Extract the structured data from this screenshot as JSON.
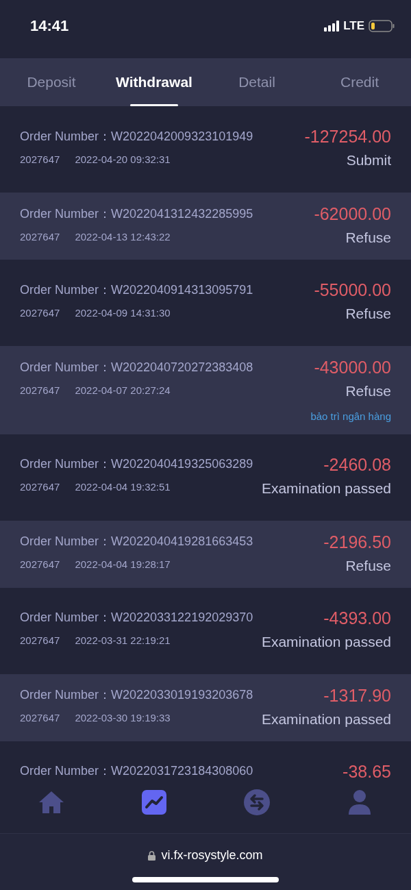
{
  "status_bar": {
    "time": "14:41",
    "network": "LTE"
  },
  "tabs": [
    {
      "label": "Deposit",
      "selected": false
    },
    {
      "label": "Withdrawal",
      "selected": true
    },
    {
      "label": "Detail",
      "selected": false
    },
    {
      "label": "Credit",
      "selected": false
    }
  ],
  "orders": [
    {
      "order_label": "Order Number：",
      "order_number": "W2022042009323101949",
      "account": "2027647",
      "time": "2022-04-20 09:32:31",
      "amount": "-127254.00",
      "status": "Submit"
    },
    {
      "order_label": "Order Number：",
      "order_number": "W2022041312432285995",
      "account": "2027647",
      "time": "2022-04-13 12:43:22",
      "amount": "-62000.00",
      "status": "Refuse"
    },
    {
      "order_label": "Order Number：",
      "order_number": "W2022040914313095791",
      "account": "2027647",
      "time": "2022-04-09 14:31:30",
      "amount": "-55000.00",
      "status": "Refuse"
    },
    {
      "order_label": "Order Number：",
      "order_number": "W2022040720272383408",
      "account": "2027647",
      "time": "2022-04-07 20:27:24",
      "amount": "-43000.00",
      "status": "Refuse",
      "note": "bảo trì ngân hàng"
    },
    {
      "order_label": "Order Number：",
      "order_number": "W2022040419325063289",
      "account": "2027647",
      "time": "2022-04-04 19:32:51",
      "amount": "-2460.08",
      "status": "Examination passed"
    },
    {
      "order_label": "Order Number：",
      "order_number": "W2022040419281663453",
      "account": "2027647",
      "time": "2022-04-04 19:28:17",
      "amount": "-2196.50",
      "status": "Refuse"
    },
    {
      "order_label": "Order Number：",
      "order_number": "W2022033122192029370",
      "account": "2027647",
      "time": "2022-03-31 22:19:21",
      "amount": "-4393.00",
      "status": "Examination passed"
    },
    {
      "order_label": "Order Number：",
      "order_number": "W2022033019193203678",
      "account": "2027647",
      "time": "2022-03-30 19:19:33",
      "amount": "-1317.90",
      "status": "Examination passed"
    },
    {
      "order_label": "Order Number：",
      "order_number": "W2022031723184308060",
      "amount": "-38.65"
    }
  ],
  "bottom_nav": [
    {
      "kind": "home",
      "selected": false
    },
    {
      "kind": "chart",
      "selected": true
    },
    {
      "kind": "exchange",
      "selected": false
    },
    {
      "kind": "user",
      "selected": false
    }
  ],
  "browser_bar": {
    "url": "vi.fx-rosystyle.com"
  }
}
